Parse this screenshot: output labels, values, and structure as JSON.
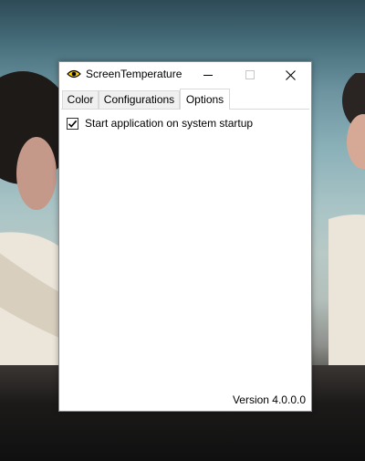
{
  "window": {
    "title": "ScreenTemperature",
    "controls": {
      "minimize_icon": "minimize-icon",
      "maximize_icon": "maximize-icon",
      "close_icon": "close-icon"
    }
  },
  "tabs": [
    {
      "label": "Color",
      "selected": false
    },
    {
      "label": "Configurations",
      "selected": false
    },
    {
      "label": "Options",
      "selected": true
    }
  ],
  "options": {
    "startup_checkbox": {
      "label": "Start application on system startup",
      "checked": true
    }
  },
  "footer": {
    "version": "Version 4.0.0.0"
  },
  "colors": {
    "accent": "#0078d7",
    "icon_yellow": "#ffd000"
  }
}
